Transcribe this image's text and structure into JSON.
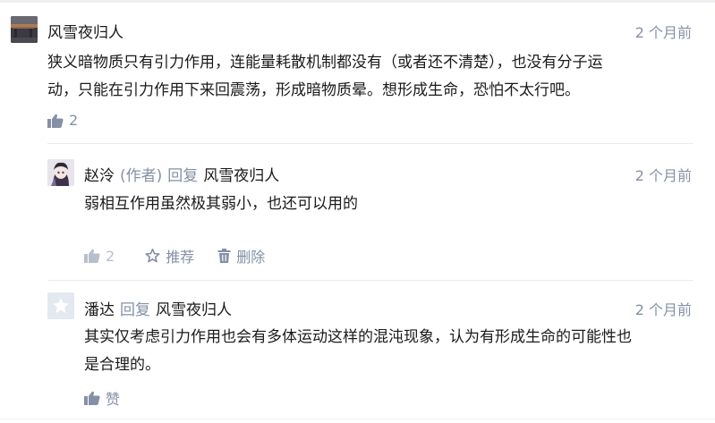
{
  "comments": {
    "top": {
      "author": "风雪夜归人",
      "time": "2 个月前",
      "text_line1": "狭义暗物质只有引力作用，连能量耗散机制都没有（或者还不清楚），也没有分子运",
      "text_line2": "动，只能在引力作用下来回震荡，形成暗物质晕。想形成生命，恐怕不太行吧。",
      "likes": "2"
    },
    "reply1": {
      "author": "赵泠",
      "role": "(作者)",
      "reply_word": "回复",
      "reply_to": "风雪夜归人",
      "time": "2 个月前",
      "text": "弱相互作用虽然极其弱小，也还可以用的",
      "likes": "2",
      "recommend": "推荐",
      "delete": "删除"
    },
    "reply2": {
      "author": "潘达",
      "reply_word": "回复",
      "reply_to": "风雪夜归人",
      "time": "2 个月前",
      "text_line1": "其实仅考虑引力作用也会有多体运动这样的混沌现象，认为有形成生命的可能性也",
      "text_line2": "是合理的。",
      "like_label": "赞"
    }
  },
  "colors": {
    "meta": "#8590a6",
    "text": "#1a1a1a",
    "divider": "#ebebeb"
  },
  "icons": [
    "thumbs-up-icon",
    "star-icon",
    "trash-icon",
    "default-avatar-star-icon"
  ]
}
